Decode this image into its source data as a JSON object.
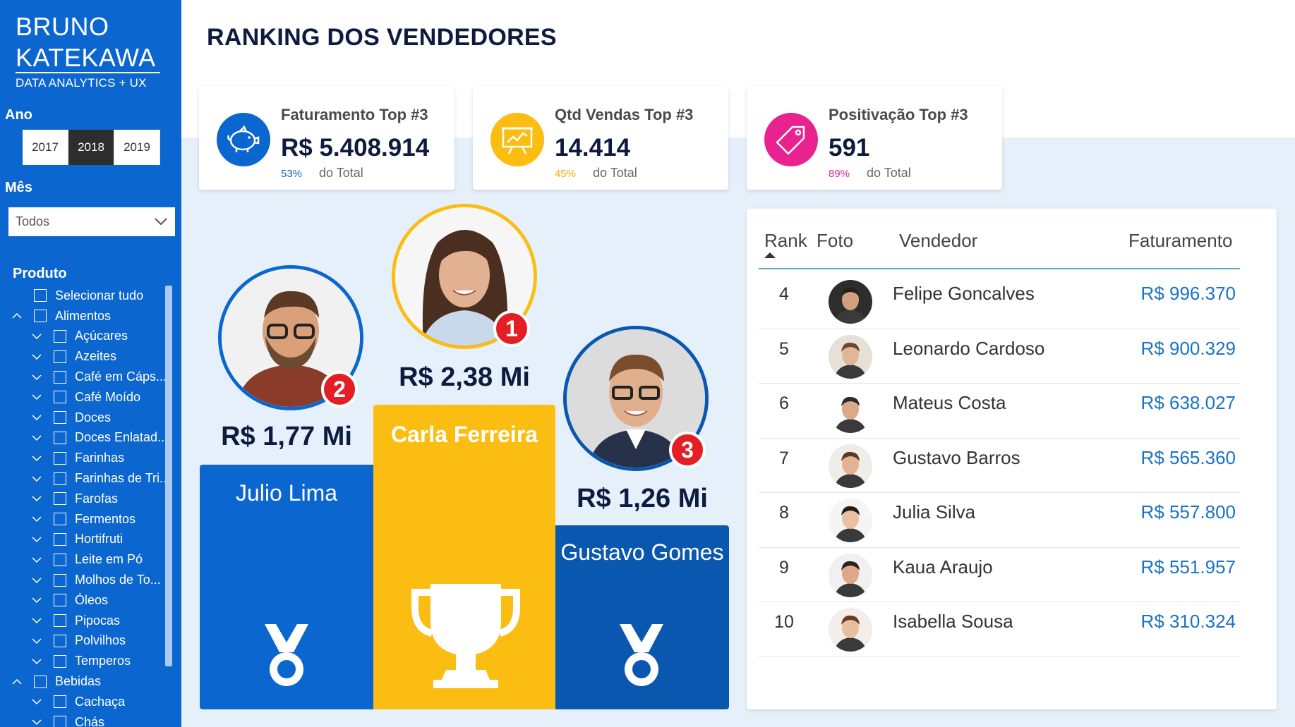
{
  "brand": {
    "line1": "BRUNO",
    "line2": "KATEKAWA",
    "subtitle": "DATA ANALYTICS + UX"
  },
  "filters": {
    "year_label": "Ano",
    "years": [
      "2017",
      "2018",
      "2019"
    ],
    "selected_year": "2018",
    "month_label": "Mês",
    "month_value": "Todos",
    "product_label": "Produto",
    "product_items": [
      {
        "label": "Selecionar tudo",
        "level": 0,
        "expander": "none"
      },
      {
        "label": "Alimentos",
        "level": 0,
        "expander": "up"
      },
      {
        "label": "Açúcares",
        "level": 1,
        "expander": "down"
      },
      {
        "label": "Azeites",
        "level": 1,
        "expander": "down"
      },
      {
        "label": "Café em Cáps...",
        "level": 1,
        "expander": "down"
      },
      {
        "label": "Café Moído",
        "level": 1,
        "expander": "down"
      },
      {
        "label": "Doces",
        "level": 1,
        "expander": "down"
      },
      {
        "label": "Doces Enlatad...",
        "level": 1,
        "expander": "down"
      },
      {
        "label": "Farinhas",
        "level": 1,
        "expander": "down"
      },
      {
        "label": "Farinhas de Tri...",
        "level": 1,
        "expander": "down"
      },
      {
        "label": "Farofas",
        "level": 1,
        "expander": "down"
      },
      {
        "label": "Fermentos",
        "level": 1,
        "expander": "down"
      },
      {
        "label": "Hortifruti",
        "level": 1,
        "expander": "down"
      },
      {
        "label": "Leite em Pó",
        "level": 1,
        "expander": "down"
      },
      {
        "label": "Molhos de To...",
        "level": 1,
        "expander": "down"
      },
      {
        "label": "Óleos",
        "level": 1,
        "expander": "down"
      },
      {
        "label": "Pipocas",
        "level": 1,
        "expander": "down"
      },
      {
        "label": "Polvilhos",
        "level": 1,
        "expander": "down"
      },
      {
        "label": "Temperos",
        "level": 1,
        "expander": "down"
      },
      {
        "label": "Bebidas",
        "level": 0,
        "expander": "up"
      },
      {
        "label": "Cachaça",
        "level": 1,
        "expander": "down"
      },
      {
        "label": "Chás",
        "level": 1,
        "expander": "down"
      }
    ]
  },
  "page_title": "RANKING DOS VENDEDORES",
  "kpis": [
    {
      "title": "Faturamento Top #3",
      "value": "R$ 5.408.914",
      "pct": "53%",
      "total_label": "do Total",
      "color": "#0b66cf",
      "icon": "piggy-bank-icon"
    },
    {
      "title": "Qtd Vendas Top #3",
      "value": "14.414",
      "pct": "45%",
      "total_label": "do Total",
      "color": "#fbbd12",
      "icon": "presentation-chart-icon"
    },
    {
      "title": "Positivação Top #3",
      "value": "591",
      "pct": "89%",
      "total_label": "do Total",
      "color": "#e8238f",
      "icon": "price-tag-icon"
    }
  ],
  "podium": {
    "first": {
      "name": "Carla Ferreira",
      "value": "R$ 2,38 Mi",
      "badge": "1"
    },
    "second": {
      "name": "Julio Lima",
      "value": "R$ 1,77 Mi",
      "badge": "2"
    },
    "third": {
      "name": "Gustavo Gomes",
      "value": "R$ 1,26 Mi",
      "badge": "3"
    }
  },
  "table": {
    "columns": {
      "rank": "Rank",
      "photo": "Foto",
      "seller": "Vendedor",
      "revenue": "Faturamento"
    },
    "rows": [
      {
        "rank": "4",
        "name": "Felipe Goncalves",
        "revenue": "R$ 996.370"
      },
      {
        "rank": "5",
        "name": "Leonardo Cardoso",
        "revenue": "R$ 900.329"
      },
      {
        "rank": "6",
        "name": "Mateus Costa",
        "revenue": "R$ 638.027"
      },
      {
        "rank": "7",
        "name": "Gustavo Barros",
        "revenue": "R$ 565.360"
      },
      {
        "rank": "8",
        "name": "Julia Silva",
        "revenue": "R$ 557.800"
      },
      {
        "rank": "9",
        "name": "Kaua Araujo",
        "revenue": "R$ 551.957"
      },
      {
        "rank": "10",
        "name": "Isabella Sousa",
        "revenue": "R$ 310.324"
      }
    ]
  },
  "colors": {
    "brand_blue": "#0b66cf",
    "dark_blue": "#0a57b0",
    "gold": "#fbbd12",
    "magenta": "#e8238f",
    "badge_red": "#e31e24",
    "link_blue": "#1a73c6"
  }
}
